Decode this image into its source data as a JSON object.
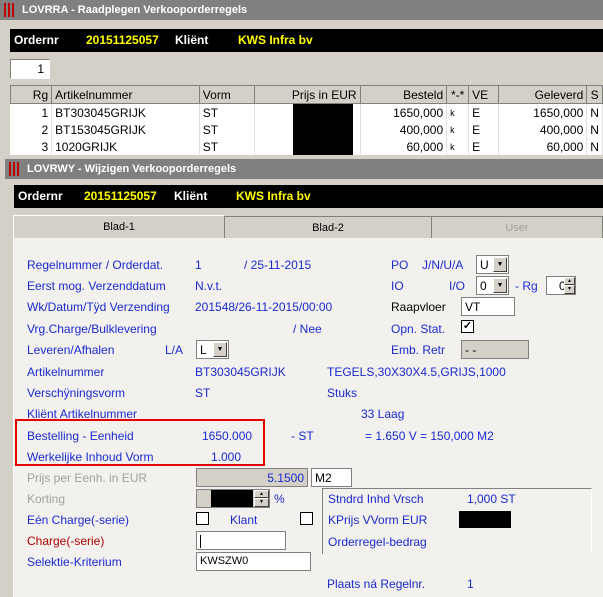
{
  "window1": {
    "title": "LOVRRA - Raadplegen Verkooporderregels",
    "ordernr_label": "Ordernr",
    "ordernr": "20151125057",
    "client_label": "Kliënt",
    "client": "KWS Infra bv",
    "page_field": "1",
    "table": {
      "headers": [
        "Rg",
        "Artikelnummer",
        "Vorm",
        "Prijs in EUR",
        "Besteld",
        "*-*",
        "VE",
        "Geleverd",
        "S"
      ],
      "rows": [
        {
          "rg": "1",
          "artikel": "BT303045GRIJK",
          "vorm": "ST",
          "besteld": "1650,000",
          "mark": "k",
          "ve": "E",
          "geleverd": "1650,000",
          "s": "N"
        },
        {
          "rg": "2",
          "artikel": "BT153045GRIJK",
          "vorm": "ST",
          "besteld": "400,000",
          "mark": "k",
          "ve": "E",
          "geleverd": "400,000",
          "s": "N"
        },
        {
          "rg": "3",
          "artikel": "1020GRIJK",
          "vorm": "ST",
          "besteld": "60,000",
          "mark": "k",
          "ve": "E",
          "geleverd": "60,000",
          "s": "N"
        }
      ]
    }
  },
  "window2": {
    "title": "LOVRWY - Wijzigen Verkooporderregels",
    "ordernr_label": "Ordernr",
    "ordernr": "20151125057",
    "client_label": "Kliënt",
    "client": "KWS Infra bv",
    "tabs": [
      "Blad-1",
      "Blad-2",
      "User"
    ],
    "form": {
      "regelnummer_label": "Regelnummer / Orderdat.",
      "regelnummer": "1",
      "orderdat": "/ 25-11-2015",
      "eerst_label": "Eerst mog. Verzenddatum",
      "eerst_value": "N.v.t.",
      "wk_label": "Wk/Datum/Tÿd Verzending",
      "wk_value": "201548/26-11-2015/00:00",
      "vrg_label": "Vrg.Charge/Bulklevering",
      "vrg_value": "/ Nee",
      "leveren_label": "Leveren/Afhalen",
      "la_label": "L/A",
      "la_value": "L",
      "artikel_label": "Artikelnummer",
      "artikel_value": "BT303045GRIJK",
      "artikel_desc": "TEGELS,30X30X4.5,GRIJS,1000",
      "verschijn_label": "Verschÿningsvorm",
      "verschijn_value": "ST",
      "verschijn_unit": "Stuks",
      "klient_art_label": "Kliënt Artikelnummer",
      "laag": "33 Laag",
      "bestelling_label": "Bestelling - Eenheid",
      "bestelling_value": "1650.000",
      "bestelling_unit": "- ST",
      "bestelling_calc": "= 1.650 V  = 150,000 M2",
      "werkelijke_label": "Werkelijke Inhoud Vorm",
      "werkelijke_value": "1.000",
      "prijs_label": "Prijs per Eenh. in EUR",
      "prijs_value": "5.1500",
      "prijs_unit": "M2",
      "korting_label": "Korting",
      "korting_pct": "%",
      "een_charge_label": "Eén Charge(-serie)",
      "klant_label": "Klant",
      "charge_label": "Charge(-serie)",
      "selektie_label": "Selektie-Kriterium",
      "selektie_value": "KWSZW0",
      "plaats_label": "Plaats ná Regelnr.",
      "plaats_value": "1",
      "po_label": "PO",
      "jnua_label": "J/N/U/A",
      "jnua_value": "U",
      "io_label": "IO",
      "io2_label": "I/O",
      "io_value": "0",
      "rg_label": "- Rg",
      "rg_value": "0",
      "raapvloer_label": "Raapvloer",
      "raapvloer_value": "VT",
      "opn_label": "Opn. Stat.",
      "opn_checked": "✓",
      "emb_label": "Emb. Retr",
      "emb_value": "- -",
      "stndrd_label": "Stndrd Inhd Vrsch",
      "stndrd_value": "1,000 ST",
      "kprijs_label": "KPrijs VVorm  EUR",
      "orderregel_label": "Orderregel-bedrag"
    }
  },
  "icons": {
    "combo_arrow": "▼",
    "spin_up": "▲",
    "spin_down": "▼"
  }
}
